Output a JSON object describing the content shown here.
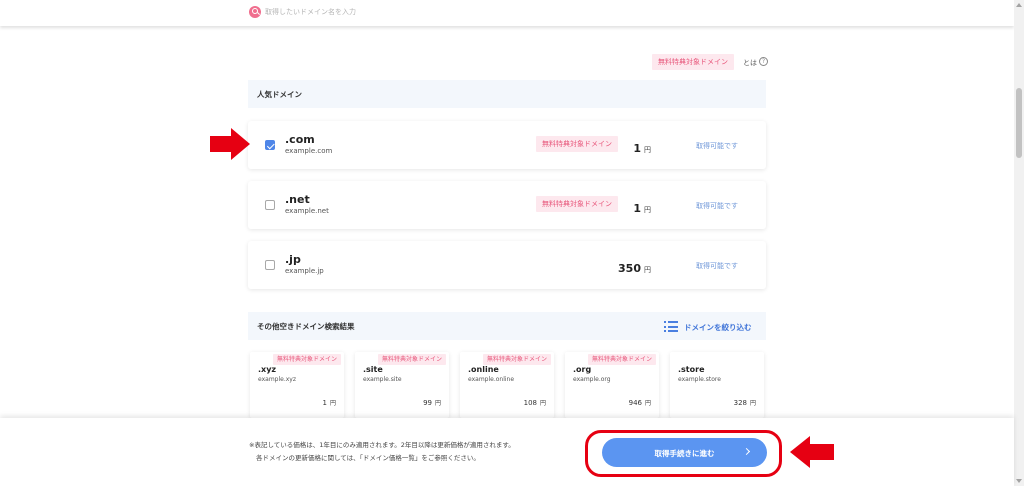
{
  "search": {
    "placeholder": "取得したいドメイン名を入力"
  },
  "badge_text": "無料特典対象ドメイン",
  "legend": {
    "toha": "とは",
    "info": "?"
  },
  "popular": {
    "title": "人気ドメイン",
    "items": [
      {
        "tld": ".com",
        "example": "example.com",
        "price": "1",
        "yen": "円",
        "status": "取得可能です",
        "checked": true,
        "badge": true
      },
      {
        "tld": ".net",
        "example": "example.net",
        "price": "1",
        "yen": "円",
        "status": "取得可能です",
        "checked": false,
        "badge": true
      },
      {
        "tld": ".jp",
        "example": "example.jp",
        "price": "350",
        "yen": "円",
        "status": "取得可能です",
        "checked": false,
        "badge": false
      }
    ]
  },
  "others": {
    "title": "その他空きドメイン検索結果",
    "filter_label": "ドメインを絞り込む",
    "items": [
      {
        "tld": ".xyz",
        "example": "example.xyz",
        "price": "1",
        "yen": "円",
        "badge": true
      },
      {
        "tld": ".site",
        "example": "example.site",
        "price": "99",
        "yen": "円",
        "badge": true
      },
      {
        "tld": ".online",
        "example": "example.online",
        "price": "108",
        "yen": "円",
        "badge": true
      },
      {
        "tld": ".org",
        "example": "example.org",
        "price": "946",
        "yen": "円",
        "badge": true
      },
      {
        "tld": ".store",
        "example": "example.store",
        "price": "328",
        "yen": "円",
        "badge": false
      }
    ]
  },
  "footer": {
    "note1": "※表記している価格は、1年目にのみ適用されます。2年目以降は更新価格が適用されます。",
    "note2": "各ドメインの更新価格に関しては、「ドメイン価格一覧」をご参照ください。",
    "proceed_label": "取得手続きに進む"
  },
  "colors": {
    "accent": "#5b95f1",
    "badge_bg": "#fde8ee",
    "badge_text": "#e8587c",
    "annotation": "#e60012"
  }
}
